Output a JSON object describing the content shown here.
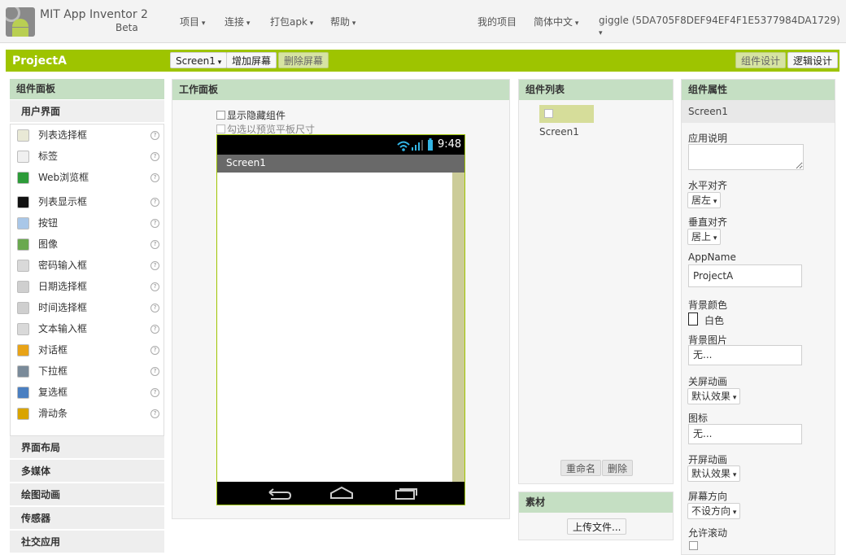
{
  "app": {
    "title": "MIT App Inventor 2",
    "subtitle": "Beta"
  },
  "topmenu": {
    "project": "项目",
    "connect": "连接",
    "build": "打包apk",
    "help": "帮助",
    "my_projects": "我的项目",
    "language": "简体中文",
    "user": "giggle (5DA705F8DEF94EF4F1E5377984DA1729)"
  },
  "projectbar": {
    "name": "ProjectA",
    "screen_select": "Screen1",
    "add_screen": "增加屏幕",
    "remove_screen": "删除屏幕",
    "designer": "组件设计",
    "blocks": "逻辑设计"
  },
  "palette": {
    "title": "组件面板",
    "open_category": "用户界面",
    "items": [
      {
        "label": "列表选择框",
        "icon": "list-picker-icon",
        "color": "#e9e9d6"
      },
      {
        "label": "标签",
        "icon": "label-icon",
        "color": "#f0f0f0"
      },
      {
        "label": "Web浏览框",
        "icon": "web-viewer-icon",
        "color": "#2d9b39"
      },
      {
        "label": "列表显示框",
        "icon": "list-view-icon",
        "color": "#111111"
      },
      {
        "label": "按钮",
        "icon": "button-icon",
        "color": "#a9c7e8"
      },
      {
        "label": "图像",
        "icon": "image-icon",
        "color": "#6aa84f"
      },
      {
        "label": "密码输入框",
        "icon": "password-textbox-icon",
        "color": "#d9d9d9"
      },
      {
        "label": "日期选择框",
        "icon": "date-picker-icon",
        "color": "#cfcfcf"
      },
      {
        "label": "时间选择框",
        "icon": "time-picker-icon",
        "color": "#cfcfcf"
      },
      {
        "label": "文本输入框",
        "icon": "textbox-icon",
        "color": "#d9d9d9"
      },
      {
        "label": "对话框",
        "icon": "notifier-icon",
        "color": "#e8a317"
      },
      {
        "label": "下拉框",
        "icon": "spinner-icon",
        "color": "#7a8a99"
      },
      {
        "label": "复选框",
        "icon": "checkbox-icon",
        "color": "#4a7fc1"
      },
      {
        "label": "滑动条",
        "icon": "slider-icon",
        "color": "#d9a400"
      }
    ],
    "help_glyph": "?",
    "categories": [
      "界面布局",
      "多媒体",
      "绘图动画",
      "传感器",
      "社交应用"
    ]
  },
  "viewer": {
    "title": "工作面板",
    "show_hidden": "显示隐藏组件",
    "tablet_preview": "勾选以预览平板尺寸",
    "clock": "9:48",
    "screen_title": "Screen1"
  },
  "components": {
    "title": "组件列表",
    "tree_root": "Screen1",
    "rename": "重命名",
    "delete": "删除"
  },
  "media": {
    "title": "素材",
    "upload": "上传文件..."
  },
  "properties": {
    "title": "组件属性",
    "component": "Screen1",
    "about_label": "应用说明",
    "about_value": "",
    "align_h_label": "水平对齐",
    "align_h_value": "居左",
    "align_v_label": "垂直对齐",
    "align_v_value": "居上",
    "appname_label": "AppName",
    "appname_value": "ProjectA",
    "bgcolor_label": "背景颜色",
    "bgcolor_value": "白色",
    "bgimage_label": "背景图片",
    "bgimage_value": "无...",
    "close_anim_label": "关屏动画",
    "close_anim_value": "默认效果",
    "icon_label": "图标",
    "icon_value": "无...",
    "open_anim_label": "开屏动画",
    "open_anim_value": "默认效果",
    "orientation_label": "屏幕方向",
    "orientation_value": "不设方向",
    "scrollable_label": "允许滚动"
  },
  "colors": {
    "accent": "#9ec400",
    "panel_header": "#c5dfc3"
  }
}
